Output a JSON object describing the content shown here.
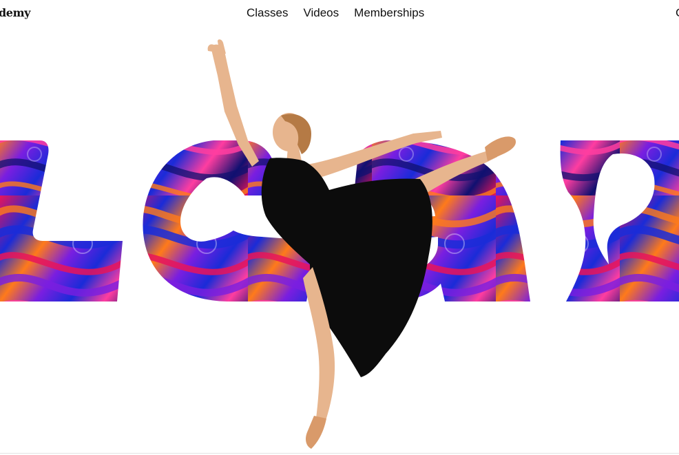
{
  "header": {
    "logo_text": "demy",
    "nav": [
      {
        "label": "Classes"
      },
      {
        "label": "Videos"
      },
      {
        "label": "Memberships"
      }
    ],
    "right_text": "C"
  },
  "hero": {
    "background_color": "#ffffff",
    "swirl_colors": [
      "#1a2bd8",
      "#e8145a",
      "#ff7a1a",
      "#7a1ee0",
      "#101070",
      "#ff3da0"
    ],
    "dress_color": "#0c0c0c",
    "skin_color": "#e7b58e"
  }
}
